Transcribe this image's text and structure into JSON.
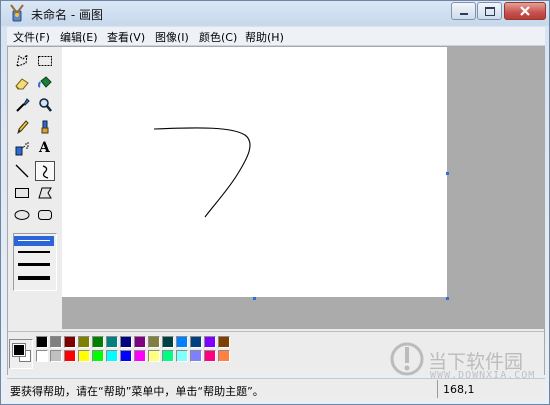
{
  "window": {
    "title": "未命名 - 画图"
  },
  "menu": {
    "items": [
      "文件(F)",
      "编辑(E)",
      "查看(V)",
      "图像(I)",
      "颜色(C)",
      "帮助(H)"
    ]
  },
  "toolbox": {
    "tools": [
      {
        "name": "free-form-select",
        "icon": "free-select-icon"
      },
      {
        "name": "rect-select",
        "icon": "rect-select-icon"
      },
      {
        "name": "eraser",
        "icon": "eraser-icon"
      },
      {
        "name": "fill",
        "icon": "fill-bucket-icon"
      },
      {
        "name": "pick-color",
        "icon": "eyedropper-icon"
      },
      {
        "name": "magnifier",
        "icon": "magnifier-icon"
      },
      {
        "name": "pencil",
        "icon": "pencil-icon"
      },
      {
        "name": "brush",
        "icon": "brush-icon"
      },
      {
        "name": "airbrush",
        "icon": "airbrush-icon"
      },
      {
        "name": "text",
        "icon": "text-icon",
        "label": "A"
      },
      {
        "name": "line",
        "icon": "line-icon"
      },
      {
        "name": "curve",
        "icon": "curve-icon"
      },
      {
        "name": "rectangle",
        "icon": "rectangle-icon"
      },
      {
        "name": "polygon",
        "icon": "polygon-icon"
      },
      {
        "name": "ellipse",
        "icon": "ellipse-icon"
      },
      {
        "name": "rounded-rect",
        "icon": "rounded-rect-icon"
      }
    ],
    "selected_tool": "curve",
    "selected_line_width": 1
  },
  "palette": {
    "foreground": "#000000",
    "background": "#FFFFFF",
    "row1": [
      "#000000",
      "#808080",
      "#800000",
      "#808000",
      "#008000",
      "#008080",
      "#000080",
      "#800080",
      "#808040",
      "#004040",
      "#0080FF",
      "#004080",
      "#8000FF",
      "#804000"
    ],
    "row2": [
      "#FFFFFF",
      "#C0C0C0",
      "#FF0000",
      "#FFFF00",
      "#00FF00",
      "#00FFFF",
      "#0000FF",
      "#FF00FF",
      "#FFFF80",
      "#00FF80",
      "#80FFFF",
      "#8080FF",
      "#FF0080",
      "#FF8040"
    ]
  },
  "status": {
    "help_text": "要获得帮助，请在“帮助”菜单中，单击“帮助主题”。",
    "coords": "168,1"
  },
  "watermark": {
    "text1": "当下软件园",
    "text2": "WWW.DOWNXIA.COM"
  }
}
